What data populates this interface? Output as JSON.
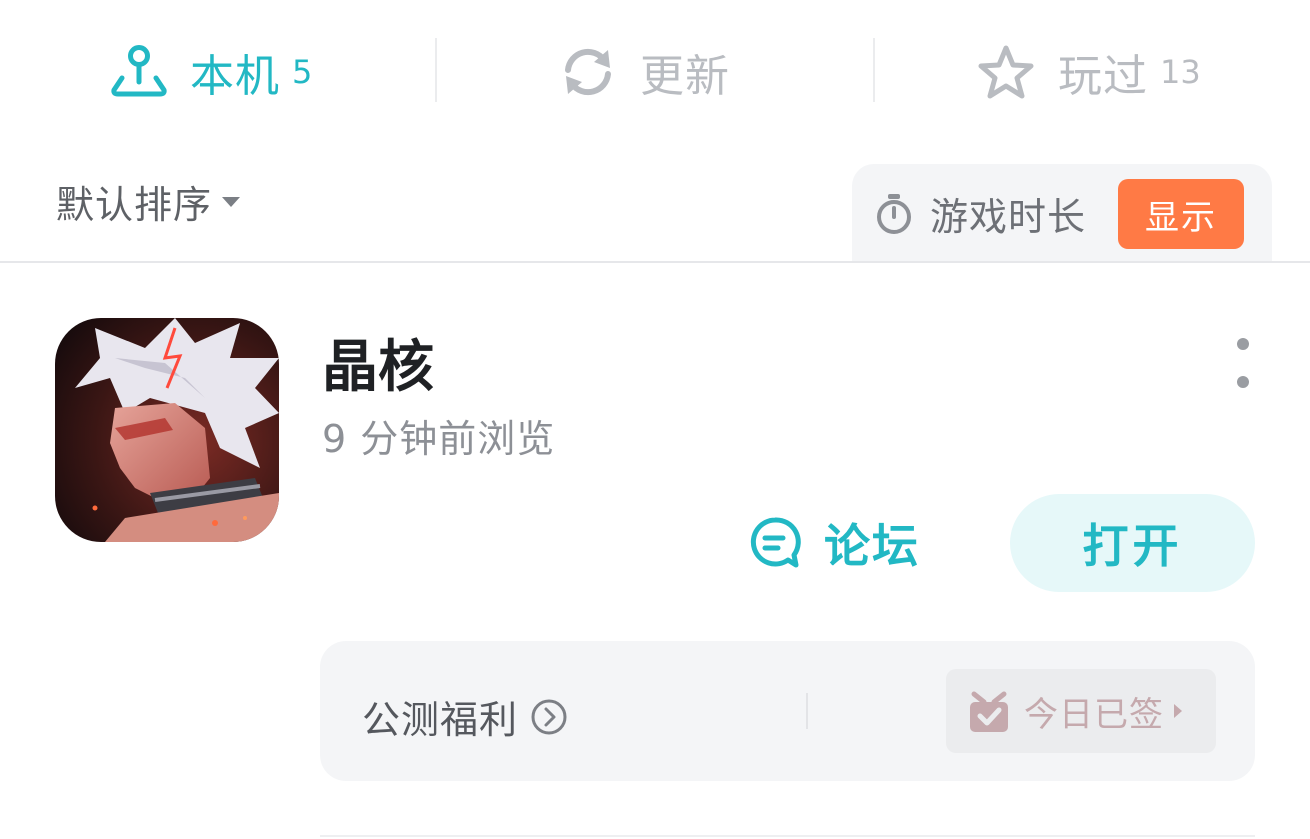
{
  "tabs": [
    {
      "label": "本机",
      "count": "5",
      "icon": "joystick-icon",
      "active": true
    },
    {
      "label": "更新",
      "count": "",
      "icon": "refresh-icon",
      "active": false
    },
    {
      "label": "玩过",
      "count": "13",
      "icon": "star-icon",
      "active": false
    }
  ],
  "sort": {
    "label": "默认排序",
    "icon": "caret-down-icon"
  },
  "duration": {
    "label": "游戏时长",
    "button_label": "显示",
    "icon": "stopwatch-icon",
    "button_color": "#ff7a45"
  },
  "game": {
    "name": "晶核",
    "subtitle": "9 分钟前浏览",
    "forum_label": "论坛",
    "open_label": "打开",
    "icon": "game-app-icon"
  },
  "welfare": {
    "label": "公测福利",
    "signed_label": "今日已签",
    "icon": "chevron-right-circle-icon",
    "gift_icon": "gift-icon"
  },
  "colors": {
    "accent": "#22b8c4",
    "orange": "#ff7a45",
    "panel_bg": "#f4f5f7"
  }
}
